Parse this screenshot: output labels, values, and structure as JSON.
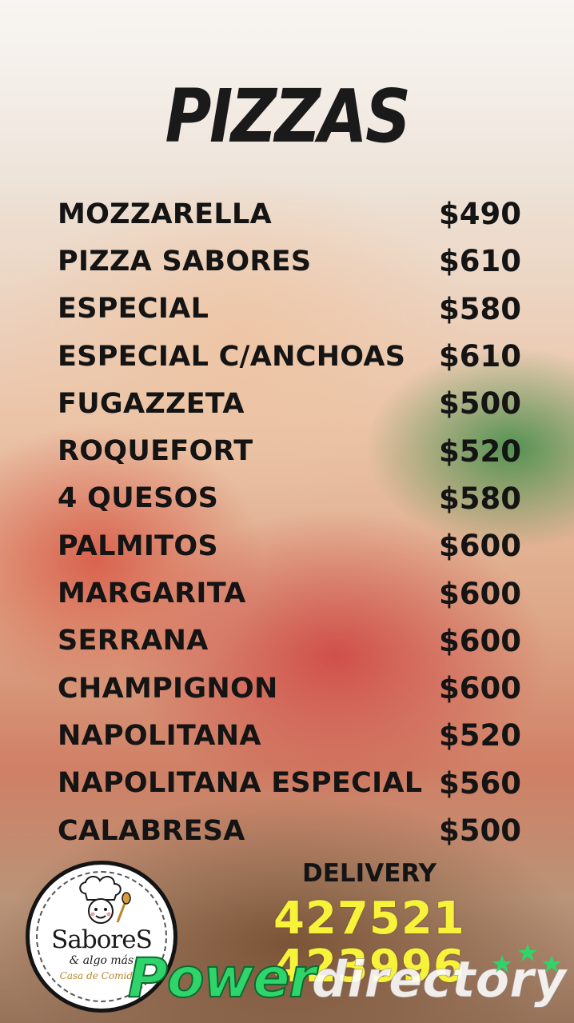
{
  "title": "PIZZAS",
  "menu": [
    {
      "name": "MOZZARELLA",
      "price": "$490"
    },
    {
      "name": "PIZZA SABORES",
      "price": "$610"
    },
    {
      "name": "ESPECIAL",
      "price": "$580"
    },
    {
      "name": "ESPECIAL C/ANCHOAS",
      "price": "$610"
    },
    {
      "name": "FUGAZZETA",
      "price": "$500"
    },
    {
      "name": "ROQUEFORT",
      "price": "$520"
    },
    {
      "name": "4 QUESOS",
      "price": "$580"
    },
    {
      "name": "PALMITOS",
      "price": "$600"
    },
    {
      "name": "MARGARITA",
      "price": "$600"
    },
    {
      "name": "SERRANA",
      "price": "$600"
    },
    {
      "name": "CHAMPIGNON",
      "price": "$600"
    },
    {
      "name": "NAPOLITANA",
      "price": "$520"
    },
    {
      "name": "NAPOLITANA ESPECIAL",
      "price": "$560"
    },
    {
      "name": "CALABRESA",
      "price": "$500"
    }
  ],
  "logo": {
    "name": "SaboreS",
    "subtitle": "& algo más",
    "tagline": "Casa de Comidas"
  },
  "delivery": {
    "label": "DELIVERY",
    "phones": [
      "427521",
      "423996"
    ]
  },
  "watermark": {
    "part1": "Power",
    "part2": "directory"
  },
  "colors": {
    "text": "#141414",
    "phone": "#f7f23a",
    "watermark_green": "#2fd46b"
  }
}
